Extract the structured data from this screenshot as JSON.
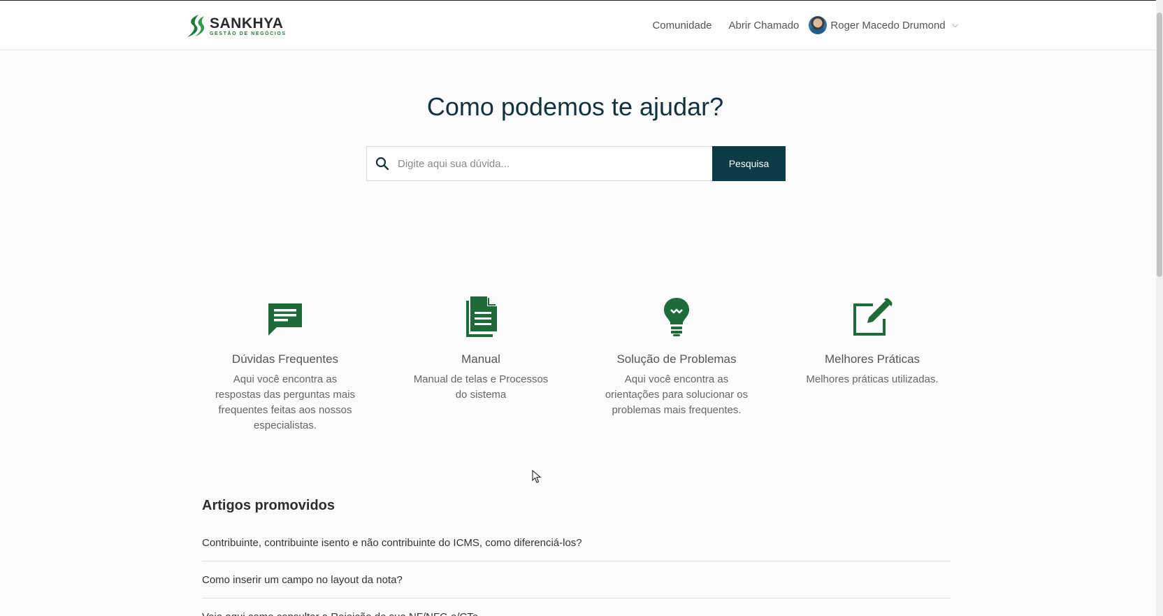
{
  "header": {
    "logo_name": "SANKHYA",
    "logo_sub": "GESTÃO DE NEGÓCIOS",
    "nav": [
      "Comunidade",
      "Abrir Chamado"
    ],
    "user_name": "Roger Macedo Drumond"
  },
  "hero": {
    "title": "Como podemos te ajudar?",
    "search_placeholder": "Digite aqui sua dúvida...",
    "search_button": "Pesquisa"
  },
  "categories": [
    {
      "icon": "chat-icon",
      "title": "Dúvidas Frequentes",
      "desc": "Aqui você encontra as respostas das perguntas mais frequentes feitas aos nossos especialistas."
    },
    {
      "icon": "document-icon",
      "title": "Manual",
      "desc": "Manual de telas e Processos do sistema"
    },
    {
      "icon": "lightbulb-icon",
      "title": "Solução de Problemas",
      "desc": "Aqui você encontra as orientações para solucionar os problemas mais frequentes."
    },
    {
      "icon": "edit-icon",
      "title": "Melhores Práticas",
      "desc": "Melhores práticas utilizadas."
    }
  ],
  "promoted": {
    "title": "Artigos promovidos",
    "items": [
      "Contribuinte, contribuinte isento e não contribuinte do ICMS, como diferenciá-los?",
      "Como inserir um campo no layout da nota?",
      "Veja aqui como consultar a Rejeição de sua NF/NFC-e/CTe"
    ]
  },
  "colors": {
    "accent": "#0d3b45",
    "icon_green": "#1e6b39",
    "title": "#12323f"
  }
}
